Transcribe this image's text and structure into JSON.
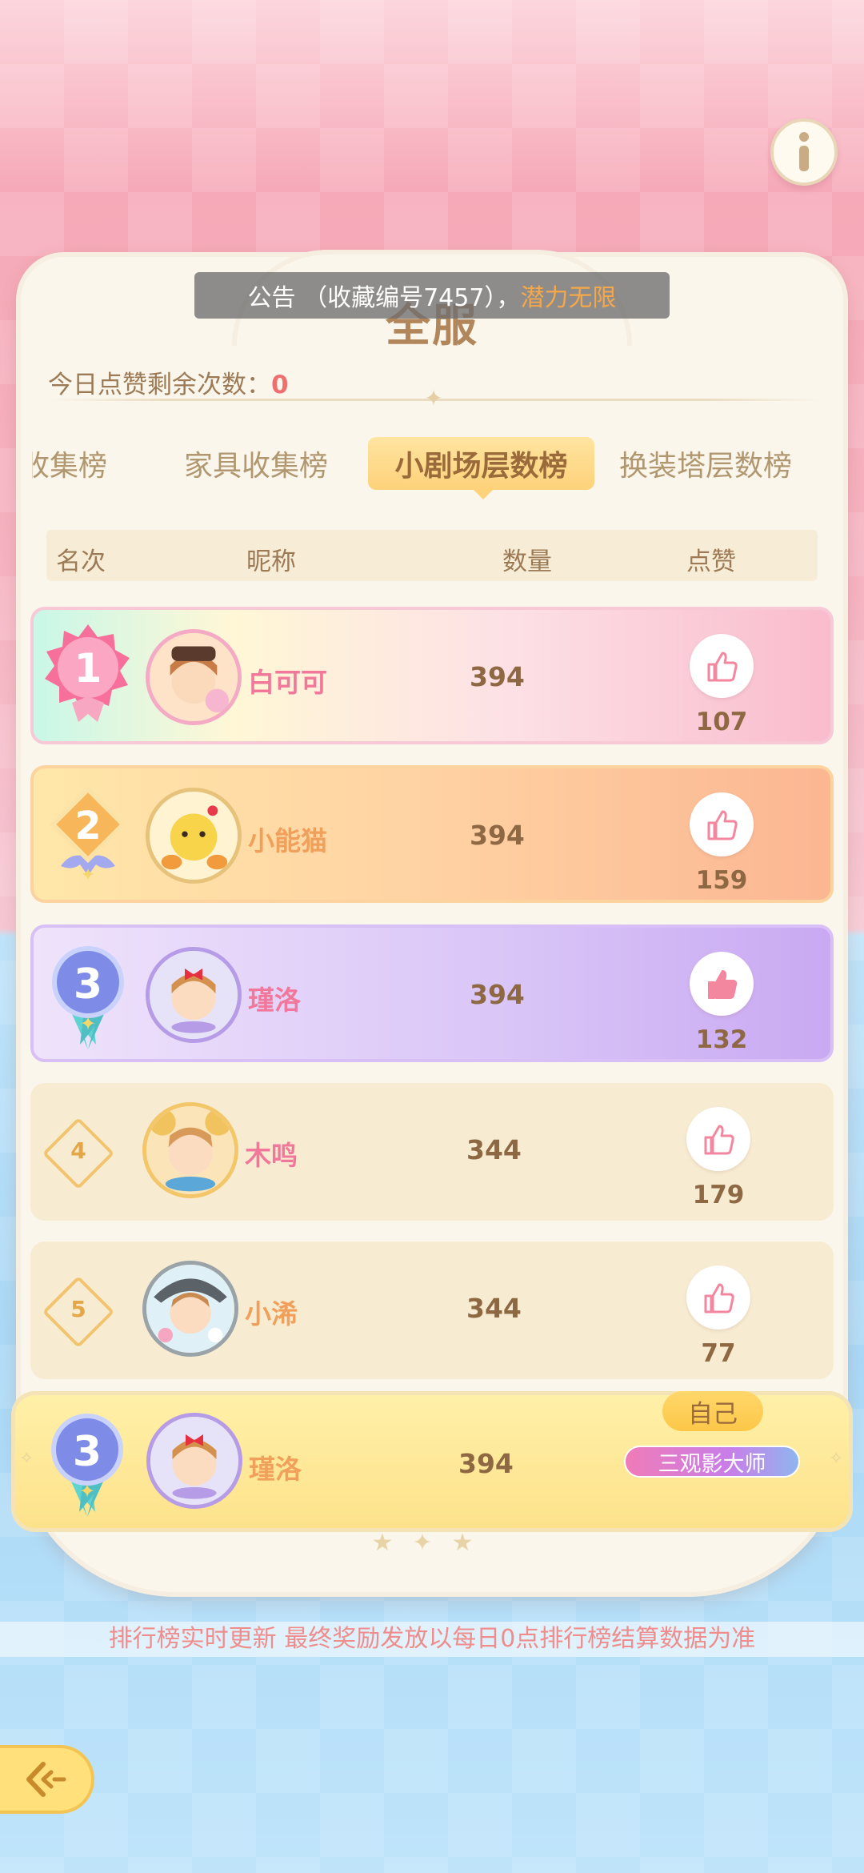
{
  "notice": {
    "prefix": "公告 （收藏编号7457），",
    "highlight": "潜力无限"
  },
  "panel": {
    "title": "全服"
  },
  "likes_remaining": {
    "label": "今日点赞剩余次数：",
    "value": "0"
  },
  "tabs": [
    {
      "label": "收集榜",
      "active": false
    },
    {
      "label": "家具收集榜",
      "active": false
    },
    {
      "label": "小剧场层数榜",
      "active": true
    },
    {
      "label": "换装塔层数榜",
      "active": false
    }
  ],
  "columns": {
    "rank": "名次",
    "nickname": "昵称",
    "count": "数量",
    "likes": "点赞"
  },
  "rows": [
    {
      "rank": "1",
      "name": "白可可",
      "count": "394",
      "likes": "107",
      "liked": false
    },
    {
      "rank": "2",
      "name": "小能猫",
      "count": "394",
      "likes": "159",
      "liked": false
    },
    {
      "rank": "3",
      "name": "瑾洛",
      "count": "394",
      "likes": "132",
      "liked": true
    },
    {
      "rank": "4",
      "name": "木鸣",
      "count": "344",
      "likes": "179",
      "liked": false
    },
    {
      "rank": "5",
      "name": "小浠",
      "count": "344",
      "likes": "77",
      "liked": false
    }
  ],
  "self_row": {
    "rank": "3",
    "name": "瑾洛",
    "count": "394",
    "tag": "自己",
    "title_badge": "三观影大师"
  },
  "footer_note": "排行榜实时更新 最终奖励发放以每日0点排行榜结算数据为准",
  "colors": {
    "name_pink": "#f1789a",
    "name_orange": "#f0a05a",
    "like_pink": "#f2879f",
    "accent_gold": "#fdd27a"
  }
}
